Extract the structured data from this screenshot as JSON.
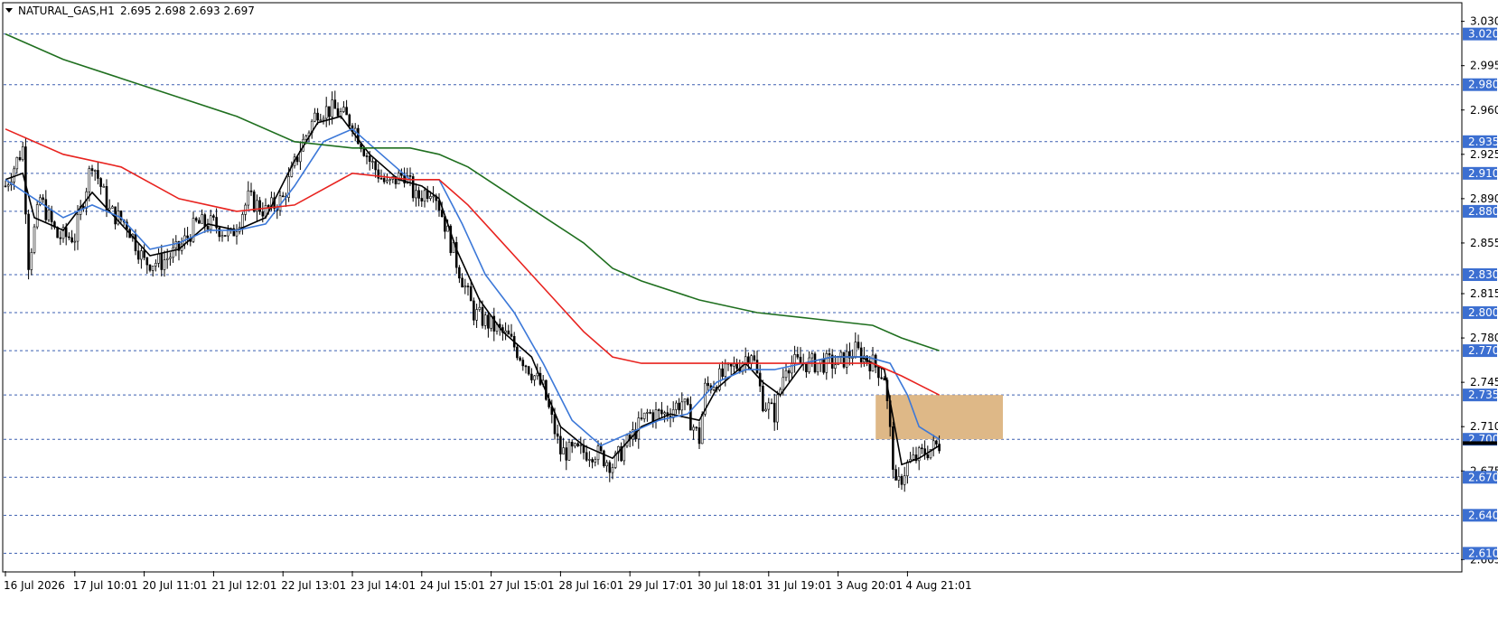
{
  "header": {
    "symbol": "NATURAL_GAS,H1",
    "ohlc": "2.695 2.698 2.693 2.697"
  },
  "chart_data": {
    "type": "candlestick",
    "symbol": "NATURAL_GAS",
    "timeframe": "H1",
    "ylim": [
      2.596,
      3.044
    ],
    "x_ticks": [
      {
        "label": "16 Jul 2026",
        "bar": 0
      },
      {
        "label": "17 Jul 10:01",
        "bar": 24
      },
      {
        "label": "20 Jul 11:01",
        "bar": 48
      },
      {
        "label": "21 Jul 12:01",
        "bar": 72
      },
      {
        "label": "22 Jul 13:01",
        "bar": 96
      },
      {
        "label": "23 Jul 14:01",
        "bar": 120
      },
      {
        "label": "24 Jul 15:01",
        "bar": 144
      },
      {
        "label": "27 Jul 15:01",
        "bar": 168
      },
      {
        "label": "28 Jul 16:01",
        "bar": 192
      },
      {
        "label": "29 Jul 17:01",
        "bar": 216
      },
      {
        "label": "30 Jul 18:01",
        "bar": 240
      },
      {
        "label": "31 Jul 19:01",
        "bar": 264
      },
      {
        "label": "3 Aug 20:01",
        "bar": 288
      },
      {
        "label": "4 Aug 21:01",
        "bar": 312
      }
    ],
    "y_ticks": [
      "3.030",
      "2.995",
      "2.960",
      "2.925",
      "2.890",
      "2.855",
      "2.815",
      "2.780",
      "2.745",
      "2.710",
      "2.675",
      "2.605"
    ],
    "levels": [
      3.02,
      2.98,
      2.935,
      2.91,
      2.88,
      2.83,
      2.8,
      2.77,
      2.735,
      2.7,
      2.67,
      2.64,
      2.61
    ],
    "current_price": 2.697,
    "zone": {
      "from_bar": 301,
      "to_bar": 345,
      "low": 2.7,
      "high": 2.735
    },
    "n_bars": 324,
    "anchors": [
      [
        0,
        2.9
      ],
      [
        6,
        2.93
      ],
      [
        8,
        2.84
      ],
      [
        12,
        2.89
      ],
      [
        18,
        2.86
      ],
      [
        24,
        2.86
      ],
      [
        30,
        2.92
      ],
      [
        36,
        2.88
      ],
      [
        42,
        2.87
      ],
      [
        48,
        2.84
      ],
      [
        54,
        2.84
      ],
      [
        60,
        2.85
      ],
      [
        66,
        2.87
      ],
      [
        72,
        2.87
      ],
      [
        78,
        2.86
      ],
      [
        84,
        2.89
      ],
      [
        90,
        2.88
      ],
      [
        96,
        2.89
      ],
      [
        102,
        2.93
      ],
      [
        108,
        2.96
      ],
      [
        114,
        2.96
      ],
      [
        120,
        2.95
      ],
      [
        126,
        2.92
      ],
      [
        132,
        2.9
      ],
      [
        138,
        2.91
      ],
      [
        142,
        2.89
      ],
      [
        148,
        2.9
      ],
      [
        152,
        2.87
      ],
      [
        156,
        2.84
      ],
      [
        162,
        2.8
      ],
      [
        168,
        2.79
      ],
      [
        174,
        2.78
      ],
      [
        180,
        2.76
      ],
      [
        186,
        2.74
      ],
      [
        192,
        2.69
      ],
      [
        198,
        2.69
      ],
      [
        204,
        2.69
      ],
      [
        210,
        2.68
      ],
      [
        216,
        2.7
      ],
      [
        222,
        2.72
      ],
      [
        228,
        2.72
      ],
      [
        234,
        2.73
      ],
      [
        240,
        2.7
      ],
      [
        242,
        2.74
      ],
      [
        248,
        2.75
      ],
      [
        254,
        2.76
      ],
      [
        258,
        2.77
      ],
      [
        262,
        2.73
      ],
      [
        266,
        2.72
      ],
      [
        270,
        2.76
      ],
      [
        276,
        2.76
      ],
      [
        282,
        2.76
      ],
      [
        288,
        2.76
      ],
      [
        294,
        2.77
      ],
      [
        300,
        2.76
      ],
      [
        304,
        2.75
      ],
      [
        308,
        2.66
      ],
      [
        312,
        2.68
      ],
      [
        318,
        2.69
      ],
      [
        323,
        2.696
      ]
    ],
    "ma_series": [
      {
        "color": "#000000",
        "values": [
          [
            0,
            2.905
          ],
          [
            6,
            2.91
          ],
          [
            10,
            2.875
          ],
          [
            20,
            2.865
          ],
          [
            30,
            2.895
          ],
          [
            40,
            2.87
          ],
          [
            50,
            2.845
          ],
          [
            60,
            2.85
          ],
          [
            70,
            2.87
          ],
          [
            80,
            2.865
          ],
          [
            90,
            2.875
          ],
          [
            100,
            2.92
          ],
          [
            108,
            2.95
          ],
          [
            116,
            2.955
          ],
          [
            126,
            2.925
          ],
          [
            136,
            2.905
          ],
          [
            144,
            2.9
          ],
          [
            150,
            2.89
          ],
          [
            156,
            2.85
          ],
          [
            164,
            2.81
          ],
          [
            172,
            2.785
          ],
          [
            182,
            2.765
          ],
          [
            192,
            2.71
          ],
          [
            200,
            2.695
          ],
          [
            210,
            2.685
          ],
          [
            220,
            2.71
          ],
          [
            230,
            2.72
          ],
          [
            240,
            2.715
          ],
          [
            246,
            2.74
          ],
          [
            256,
            2.76
          ],
          [
            262,
            2.745
          ],
          [
            268,
            2.735
          ],
          [
            276,
            2.76
          ],
          [
            286,
            2.765
          ],
          [
            296,
            2.765
          ],
          [
            304,
            2.755
          ],
          [
            310,
            2.68
          ],
          [
            316,
            2.685
          ],
          [
            323,
            2.695
          ]
        ]
      },
      {
        "color": "#3c78d8",
        "values": [
          [
            0,
            2.905
          ],
          [
            10,
            2.89
          ],
          [
            20,
            2.875
          ],
          [
            30,
            2.885
          ],
          [
            40,
            2.875
          ],
          [
            50,
            2.85
          ],
          [
            60,
            2.855
          ],
          [
            70,
            2.865
          ],
          [
            80,
            2.865
          ],
          [
            90,
            2.87
          ],
          [
            100,
            2.9
          ],
          [
            110,
            2.935
          ],
          [
            120,
            2.945
          ],
          [
            130,
            2.925
          ],
          [
            140,
            2.905
          ],
          [
            150,
            2.905
          ],
          [
            158,
            2.87
          ],
          [
            166,
            2.83
          ],
          [
            176,
            2.8
          ],
          [
            186,
            2.76
          ],
          [
            196,
            2.715
          ],
          [
            206,
            2.695
          ],
          [
            216,
            2.705
          ],
          [
            226,
            2.715
          ],
          [
            236,
            2.72
          ],
          [
            246,
            2.745
          ],
          [
            256,
            2.755
          ],
          [
            266,
            2.755
          ],
          [
            276,
            2.76
          ],
          [
            286,
            2.765
          ],
          [
            298,
            2.765
          ],
          [
            306,
            2.76
          ],
          [
            312,
            2.735
          ],
          [
            316,
            2.71
          ],
          [
            323,
            2.7
          ]
        ]
      },
      {
        "color": "#e8231f",
        "values": [
          [
            0,
            2.945
          ],
          [
            20,
            2.925
          ],
          [
            40,
            2.915
          ],
          [
            60,
            2.89
          ],
          [
            80,
            2.88
          ],
          [
            100,
            2.885
          ],
          [
            120,
            2.91
          ],
          [
            140,
            2.905
          ],
          [
            150,
            2.905
          ],
          [
            160,
            2.885
          ],
          [
            170,
            2.86
          ],
          [
            180,
            2.835
          ],
          [
            190,
            2.81
          ],
          [
            200,
            2.785
          ],
          [
            210,
            2.765
          ],
          [
            220,
            2.76
          ],
          [
            240,
            2.76
          ],
          [
            260,
            2.76
          ],
          [
            280,
            2.76
          ],
          [
            300,
            2.76
          ],
          [
            310,
            2.75
          ],
          [
            323,
            2.735
          ]
        ]
      },
      {
        "color": "#1f6f1f",
        "values": [
          [
            0,
            3.02
          ],
          [
            20,
            3.0
          ],
          [
            40,
            2.985
          ],
          [
            60,
            2.97
          ],
          [
            80,
            2.955
          ],
          [
            100,
            2.935
          ],
          [
            120,
            2.93
          ],
          [
            140,
            2.93
          ],
          [
            150,
            2.925
          ],
          [
            160,
            2.915
          ],
          [
            170,
            2.9
          ],
          [
            180,
            2.885
          ],
          [
            190,
            2.87
          ],
          [
            200,
            2.855
          ],
          [
            210,
            2.835
          ],
          [
            220,
            2.825
          ],
          [
            240,
            2.81
          ],
          [
            260,
            2.8
          ],
          [
            280,
            2.795
          ],
          [
            300,
            2.79
          ],
          [
            310,
            2.78
          ],
          [
            323,
            2.77
          ]
        ]
      }
    ]
  }
}
